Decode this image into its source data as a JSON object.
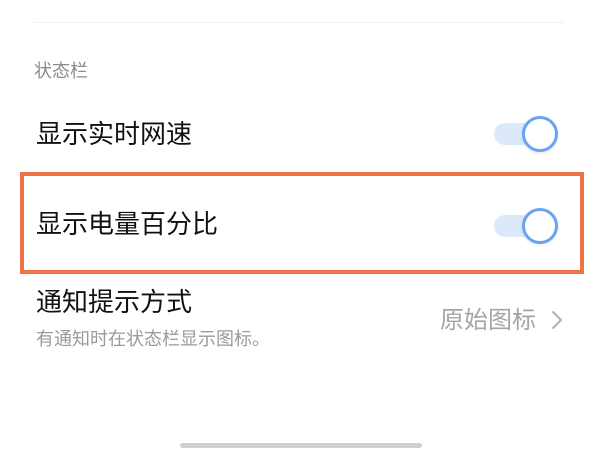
{
  "status_bar_section": {
    "header": "状态栏",
    "rows": [
      {
        "label": "显示实时网速",
        "toggle_on": true
      },
      {
        "label": "显示电量百分比",
        "toggle_on": true
      }
    ]
  },
  "notification_style": {
    "title": "通知提示方式",
    "subtitle": "有通知时在状态栏显示图标。",
    "value": "原始图标",
    "chevron_icon": "chevron-right-icon"
  },
  "colors": {
    "toggle_track": "#dce9fb",
    "toggle_knob_border": "#6aa4ee",
    "highlight": "#ee7446"
  }
}
